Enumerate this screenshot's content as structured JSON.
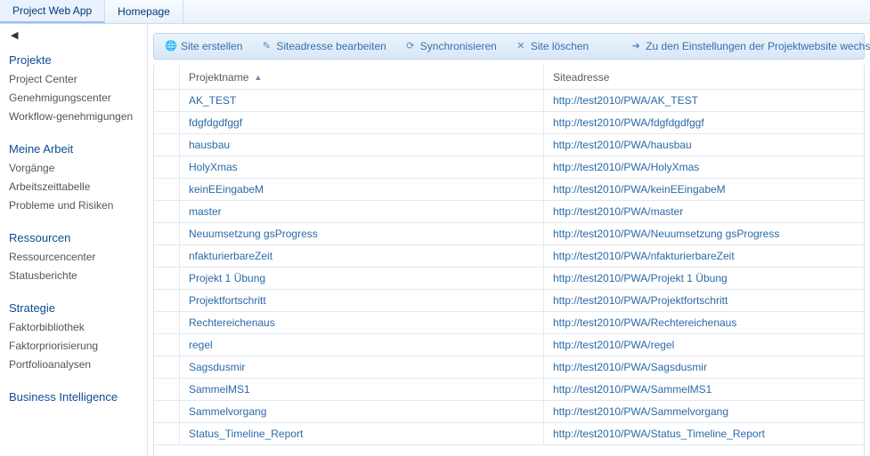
{
  "topbar": {
    "tabs": [
      {
        "label": "Project Web App",
        "active": true
      },
      {
        "label": "Homepage",
        "active": false
      }
    ]
  },
  "sidebar": {
    "groups": [
      {
        "title": "Projekte",
        "items": [
          "Project Center",
          "Genehmigungscenter",
          "Workflow-genehmigungen"
        ]
      },
      {
        "title": "Meine Arbeit",
        "items": [
          "Vorgänge",
          "Arbeitszeittabelle",
          "Probleme und Risiken"
        ]
      },
      {
        "title": "Ressourcen",
        "items": [
          "Ressourcencenter",
          "Statusberichte"
        ]
      },
      {
        "title": "Strategie",
        "items": [
          "Faktorbibliothek",
          "Faktorpriorisierung",
          "Portfolioanalysen"
        ]
      },
      {
        "title": "Business Intelligence",
        "items": []
      }
    ]
  },
  "toolbar": {
    "create": "Site erstellen",
    "edit": "Siteadresse bearbeiten",
    "sync": "Synchronisieren",
    "delete": "Site löschen",
    "settings": "Zu den Einstellungen der Projektwebsite wechseln"
  },
  "grid": {
    "columns": {
      "name": "Projektname",
      "address": "Siteadresse"
    },
    "rows": [
      {
        "name": "AK_TEST",
        "address": "http://test2010/PWA/AK_TEST"
      },
      {
        "name": "fdgfdgdfggf",
        "address": "http://test2010/PWA/fdgfdgdfggf"
      },
      {
        "name": "hausbau",
        "address": "http://test2010/PWA/hausbau"
      },
      {
        "name": "HolyXmas",
        "address": "http://test2010/PWA/HolyXmas"
      },
      {
        "name": "keinEEingabeM",
        "address": "http://test2010/PWA/keinEEingabeM"
      },
      {
        "name": "master",
        "address": "http://test2010/PWA/master"
      },
      {
        "name": "Neuumsetzung gsProgress",
        "address": "http://test2010/PWA/Neuumsetzung gsProgress"
      },
      {
        "name": "nfakturierbareZeit",
        "address": "http://test2010/PWA/nfakturierbareZeit"
      },
      {
        "name": "Projekt 1 Übung",
        "address": "http://test2010/PWA/Projekt 1 Übung"
      },
      {
        "name": "Projektfortschritt",
        "address": "http://test2010/PWA/Projektfortschritt"
      },
      {
        "name": "Rechtereichenaus",
        "address": "http://test2010/PWA/Rechtereichenaus"
      },
      {
        "name": "regel",
        "address": "http://test2010/PWA/regel"
      },
      {
        "name": "Sagsdusmir",
        "address": "http://test2010/PWA/Sagsdusmir"
      },
      {
        "name": "SammelMS1",
        "address": "http://test2010/PWA/SammelMS1"
      },
      {
        "name": "Sammelvorgang",
        "address": "http://test2010/PWA/Sammelvorgang"
      },
      {
        "name": "Status_Timeline_Report",
        "address": "http://test2010/PWA/Status_Timeline_Report"
      }
    ]
  }
}
